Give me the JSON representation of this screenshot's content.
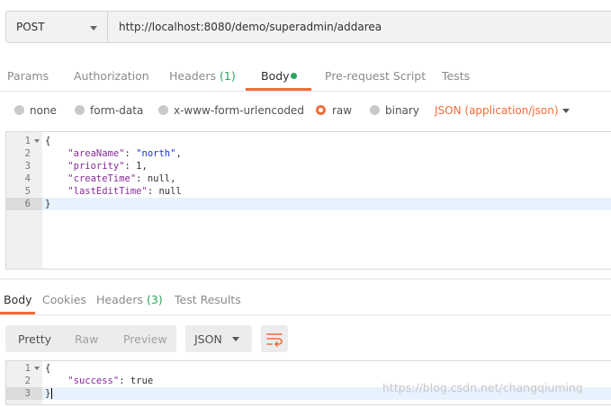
{
  "request": {
    "method": "POST",
    "url": "http://localhost:8080/demo/superadmin/addarea"
  },
  "request_tabs": [
    {
      "label": "Params"
    },
    {
      "label": "Authorization"
    },
    {
      "label": "Headers",
      "count": "(1)"
    },
    {
      "label": "Body",
      "active": true
    },
    {
      "label": "Pre-request Script"
    },
    {
      "label": "Tests"
    }
  ],
  "body_types": [
    {
      "label": "none"
    },
    {
      "label": "form-data"
    },
    {
      "label": "x-www-form-urlencoded"
    },
    {
      "label": "raw",
      "selected": true
    },
    {
      "label": "binary"
    }
  ],
  "content_type": "JSON (application/json)",
  "request_body": {
    "line_numbers": [
      "1",
      "2",
      "3",
      "4",
      "5",
      "6"
    ],
    "open": "{",
    "close": "}",
    "fields": [
      {
        "key": "\"areaName\"",
        "sep": ": ",
        "value": "\"north\"",
        "trail": ","
      },
      {
        "key": "\"priority\"",
        "sep": ": ",
        "value": "1",
        "trail": ","
      },
      {
        "key": "\"createTime\"",
        "sep": ": ",
        "value": "null",
        "trail": ","
      },
      {
        "key": "\"lastEditTime\"",
        "sep": ": ",
        "value": "null",
        "trail": ""
      }
    ]
  },
  "response_tabs": [
    {
      "label": "Body",
      "active": true
    },
    {
      "label": "Cookies"
    },
    {
      "label": "Headers",
      "count": "(3)"
    },
    {
      "label": "Test Results"
    }
  ],
  "view_modes": [
    "Pretty",
    "Raw",
    "Preview"
  ],
  "format": "JSON",
  "response_body": {
    "line_numbers": [
      "1",
      "2",
      "3"
    ],
    "open": "{",
    "close": "}",
    "key": "\"success\"",
    "sep": ": ",
    "value": "true"
  },
  "watermark": "https://blog.csdn.net/changqiuming",
  "colors": {
    "accent": "#f26b3a",
    "count_green": "#2aa65a",
    "json_key": "#8a2a9e",
    "json_string": "#1b2fd1"
  }
}
